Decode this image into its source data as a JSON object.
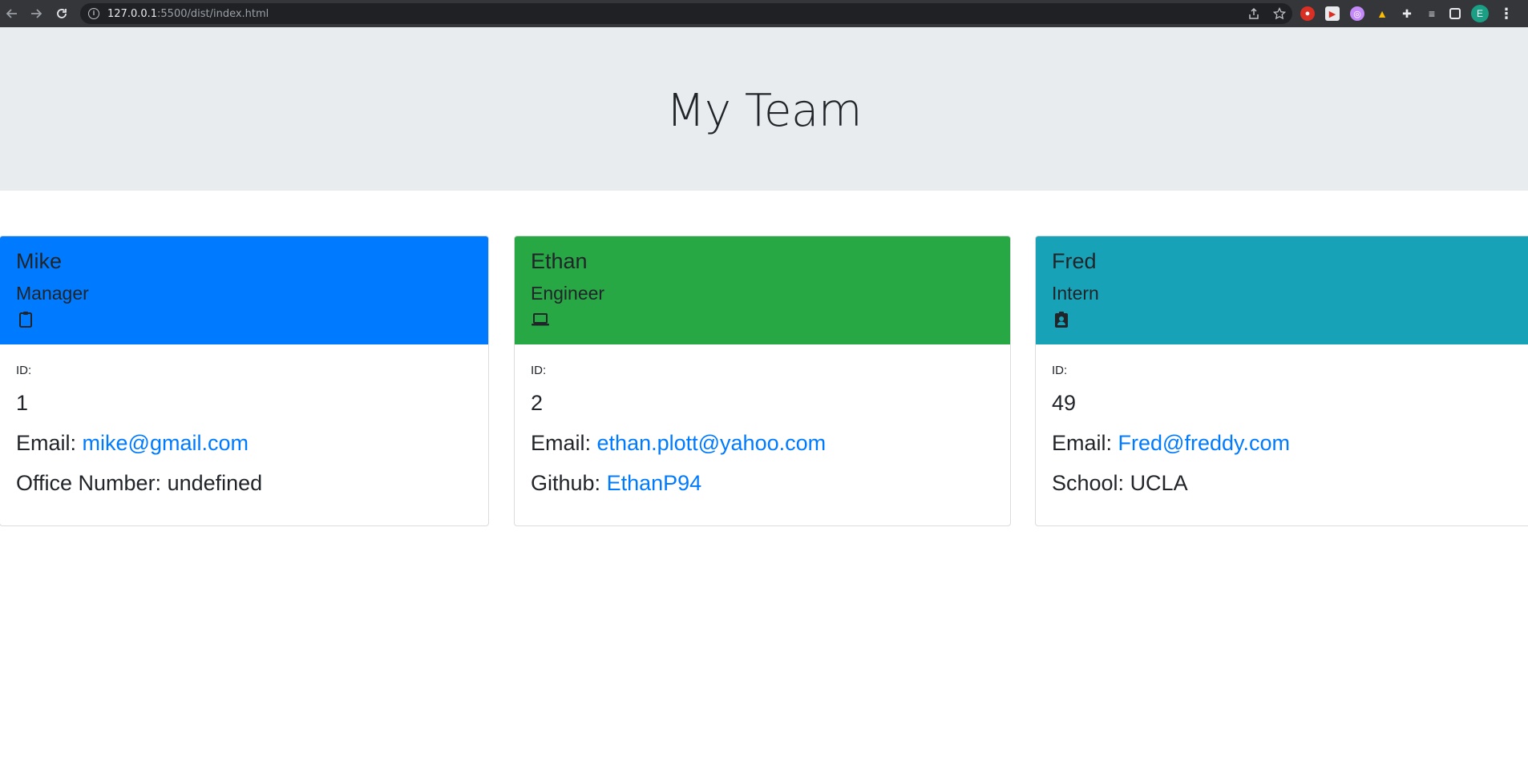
{
  "browser": {
    "url_host": "127.0.0.1",
    "url_path": ":5500/dist/index.html",
    "profile_initial": "E"
  },
  "header": {
    "title": "My Team"
  },
  "cards": [
    {
      "name": "Mike",
      "role": "Manager",
      "icon": "clipboard-icon",
      "header_color": "#007bff",
      "id_label": "ID:",
      "id": "1",
      "email_label": "Email: ",
      "email": "mike@gmail.com",
      "extra_label": "Office Number: ",
      "extra_value": "undefined"
    },
    {
      "name": "Ethan",
      "role": "Engineer",
      "icon": "laptop-icon",
      "header_color": "#28a745",
      "id_label": "ID:",
      "id": "2",
      "email_label": "Email: ",
      "email": "ethan.plott@yahoo.com",
      "extra_label": "Github: ",
      "extra_value": "EthanP94"
    },
    {
      "name": "Fred",
      "role": "Intern",
      "icon": "badge-icon",
      "header_color": "#17a2b8",
      "id_label": "ID:",
      "id": "49",
      "email_label": "Email: ",
      "email": "Fred@freddy.com",
      "extra_label": "School: ",
      "extra_value": "UCLA"
    }
  ]
}
